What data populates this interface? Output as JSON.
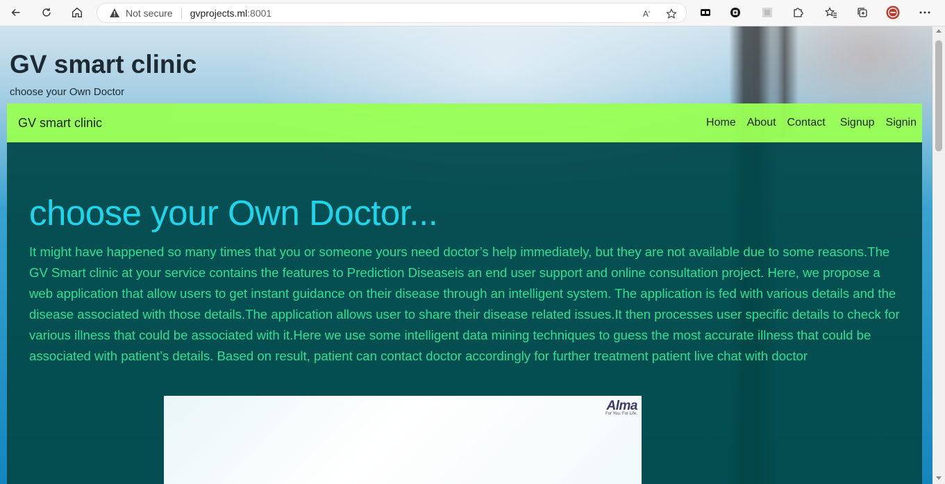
{
  "browser": {
    "not_secure_label": "Not secure",
    "url_host": "gvprojects.ml",
    "url_port": ":8001",
    "reader_icon_text": "Aʹ"
  },
  "site": {
    "title": "GV smart clinic",
    "subtitle": "choose your Own Doctor"
  },
  "navbar": {
    "brand": "GV smart clinic",
    "links": [
      "Home",
      "About",
      "Contact",
      "Signup",
      "Signin"
    ],
    "background_color": "#99ff55"
  },
  "hero": {
    "heading": "choose your Own Doctor...",
    "body": "It might have happened so many times that you or someone yours need doctor’s help immediately, but they are not available due to some reasons.The GV Smart clinic at your service contains the features to Prediction Diseaseis an end user support and online consultation project. Here, we propose a web application that allow users to get instant guidance on their disease through an intelligent system. The application is fed with various details and the disease associated with those details.The application allows user to share their disease related issues.It then processes user specific details to check for various illness that could be associated with it.Here we use some intelligent data mining techniques to guess the most accurate illness that could be associated with patient’s details. Based on result, patient can contact doctor accordingly for further treatment patient live chat with doctor",
    "heading_color": "#1ed6ec",
    "body_color": "#2fe08f"
  },
  "image": {
    "logo_text": "Alma",
    "logo_tagline": "For You. For Life."
  }
}
